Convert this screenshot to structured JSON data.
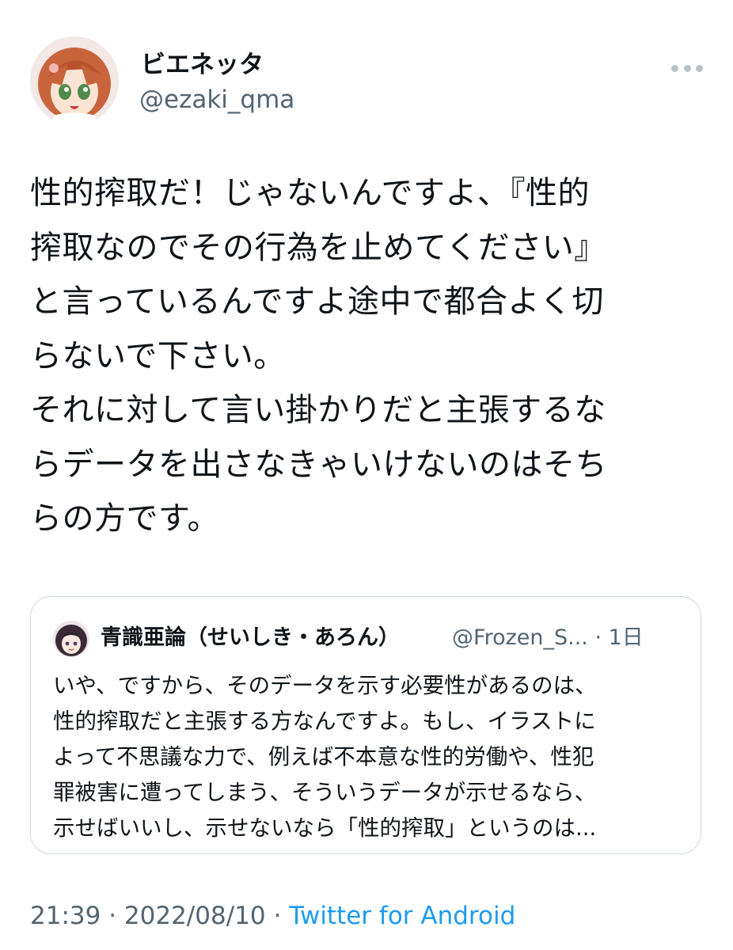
{
  "author": {
    "display_name": "ビエネッタ",
    "handle": "@ezaki_qma",
    "avatar_icon": "anime-girl-avatar-icon"
  },
  "more_icon": "more-horizontal-icon",
  "tweet": {
    "lines": [
      "性的搾取だ！じゃないんですよ、『性的",
      "搾取なのでその行為を止めてください』",
      "と言っているんですよ途中で都合よく切",
      "らないで下さい。",
      "それに対して言い掛かりだと主張するな",
      "らデータを出さなきゃいけないのはそち",
      "らの方です。"
    ]
  },
  "quote": {
    "avatar_icon": "anime-girl-dark-hair-avatar-icon",
    "display_name": "青識亜論（せいしき・あろん）",
    "handle_and_time": "@Frozen_S... · 1日",
    "lines": [
      "いや、ですから、そのデータを示す必要性があるのは、",
      "性的搾取だと主張する方なんですよ。もし、イラストに",
      "よって不思議な力で、例えば不本意な性的労働や、性犯",
      "罪被害に遭ってしまう、そういうデータが示せるなら、",
      "示せばいいし、示せないなら「性的搾取」というのは..."
    ]
  },
  "meta": {
    "time": "21:39",
    "separator_1": " · ",
    "date": "2022/08/10",
    "separator_2": " · ",
    "source": "Twitter for Android"
  },
  "colors": {
    "text_primary": "#0f1419",
    "text_secondary": "#536471",
    "link": "#1d9bf0",
    "border": "#cfd9de"
  }
}
